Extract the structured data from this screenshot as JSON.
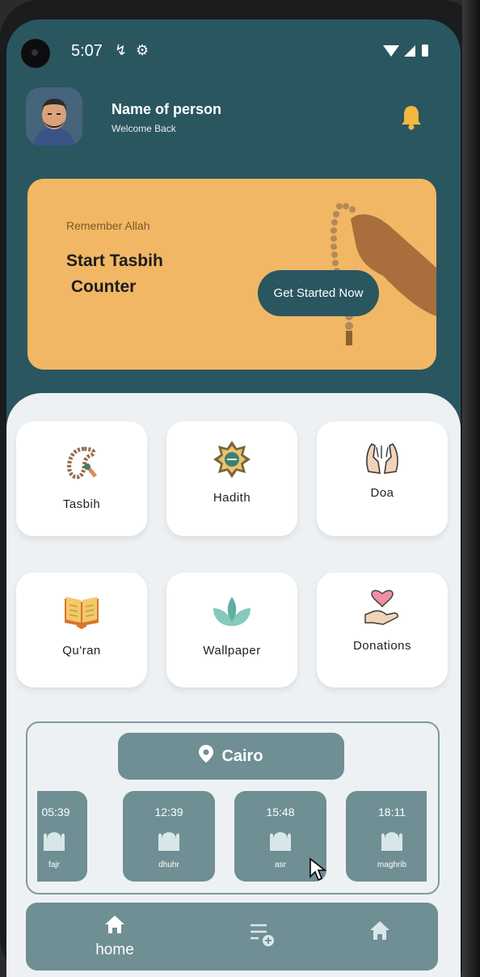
{
  "status_bar": {
    "time": "5:07"
  },
  "header": {
    "name": "Name of person",
    "subtitle": "Welcome Back"
  },
  "banner": {
    "eyebrow": "Remember Allah",
    "title": "Start Tasbih\n Counter",
    "button": "Get Started Now"
  },
  "grid": [
    {
      "label": "Tasbih",
      "icon": "prayer-beads-icon"
    },
    {
      "label": "Hadith",
      "icon": "islamic-star-icon"
    },
    {
      "label": "Doa",
      "icon": "praying-hands-icon"
    },
    {
      "label": "Qu'ran",
      "icon": "open-book-icon"
    },
    {
      "label": "Wallpaper",
      "icon": "lotus-icon"
    },
    {
      "label": "Donations",
      "icon": "heart-hand-icon"
    }
  ],
  "location": {
    "city": "Cairo"
  },
  "prayers": [
    {
      "time": "05:39",
      "name": "fajr"
    },
    {
      "time": "12:39",
      "name": "dhuhr"
    },
    {
      "time": "15:48",
      "name": "asr"
    },
    {
      "time": "18:11",
      "name": "maghrib"
    }
  ],
  "nav": {
    "home_label": "home"
  },
  "colors": {
    "primary": "#2a5660",
    "banner": "#f1b765",
    "tile": "#6f8f94",
    "panel": "#eef1f3",
    "bell": "#f4b740"
  }
}
